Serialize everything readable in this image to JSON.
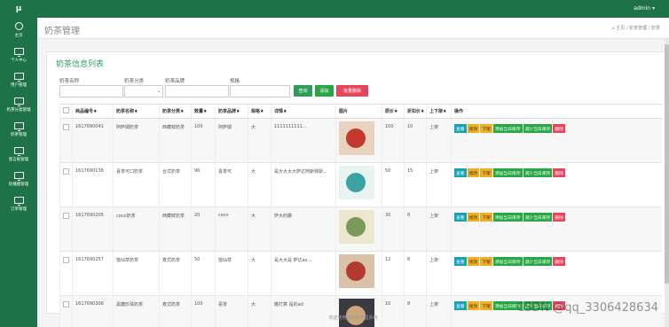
{
  "app": {
    "logo": "μ",
    "user": "admin ▾"
  },
  "sidebar": {
    "items": [
      {
        "label": "主页",
        "icon": "palette-icon"
      },
      {
        "label": "个人中心",
        "icon": "monitor-icon"
      },
      {
        "label": "用户管理",
        "icon": "monitor-icon"
      },
      {
        "label": "奶茶分类管理",
        "icon": "monitor-icon"
      },
      {
        "label": "奶茶管理",
        "icon": "monitor-icon"
      },
      {
        "label": "留言板管理",
        "icon": "monitor-icon"
      },
      {
        "label": "轮播图管理",
        "icon": "monitor-icon"
      },
      {
        "label": "订单管理",
        "icon": "monitor-icon"
      }
    ]
  },
  "header": {
    "title": "奶茶管理",
    "breadcrumb": "⌂ 主页 / 奶茶管理 / 奶茶"
  },
  "card": {
    "title": "奶茶信息列表"
  },
  "filters": {
    "name_label": "奶茶名称",
    "category_label": "奶茶分类",
    "brand_label": "奶茶品牌",
    "spec_label": "规格",
    "search_btn": "查询",
    "add_btn": "添加",
    "batch_delete_btn": "批量删除"
  },
  "table": {
    "headers": [
      "",
      "商品编号♦",
      "奶茶名称♦",
      "奶茶分类♦",
      "数量♦",
      "奶茶品牌♦",
      "规格♦",
      "详情♦",
      "图片",
      "原价♦",
      "折扣价♦",
      "上下架♦",
      "操作"
    ],
    "rows": [
      {
        "id": "1617690041",
        "name": "阿萨姆奶茶",
        "category": "西藏鲜奶茶",
        "qty": "100",
        "brand": "阿萨姆",
        "spec": "大",
        "detail": "1111111111...",
        "price": "100",
        "discount": "10",
        "status": "上架"
      },
      {
        "id": "1617690138",
        "name": "喜茶可口奶茶",
        "category": "台式奶茶",
        "qty": "96",
        "brand": "喜茶可",
        "spec": "大",
        "detail": "是大大大大萨达阿斯特斯...",
        "price": "50",
        "discount": "15",
        "status": "上架"
      },
      {
        "id": "1617690205",
        "name": "coco奶茶",
        "category": "西藏鲜奶茶",
        "qty": "20",
        "brand": "coco",
        "spec": "大",
        "detail": "萨大的撒",
        "price": "30",
        "discount": "8",
        "status": "上架"
      },
      {
        "id": "1617690257",
        "name": "悠仙草奶茶",
        "category": "麦式奶茶",
        "qty": "50",
        "brand": "悠仙草",
        "spec": "大",
        "detail": "是大大是 萨达as ...",
        "price": "12",
        "discount": "8",
        "status": "上架"
      },
      {
        "id": "1617690306",
        "name": "黑糖珍珠奶茶",
        "category": "麦式奶茶",
        "qty": "100",
        "brand": "喜茶",
        "spec": "大",
        "detail": "撒打算 是的ad",
        "price": "10",
        "discount": "8",
        "status": "上架"
      }
    ],
    "ops": {
      "view": "查看",
      "edit": "修改",
      "down": "下架",
      "add_stock": "添加当日库存",
      "reduce_stock": "减少当日库存",
      "delete": "删除"
    }
  },
  "footer": {
    "text": "欢迎使用奶茶店管理系统"
  },
  "watermark": "CSDN @qq_3306428634",
  "colors": {
    "brand_green": "#1d7248",
    "accent_green": "#2e9d5c",
    "danger": "#e8455a",
    "info": "#17a2b8",
    "warning": "#f0ad1e"
  }
}
